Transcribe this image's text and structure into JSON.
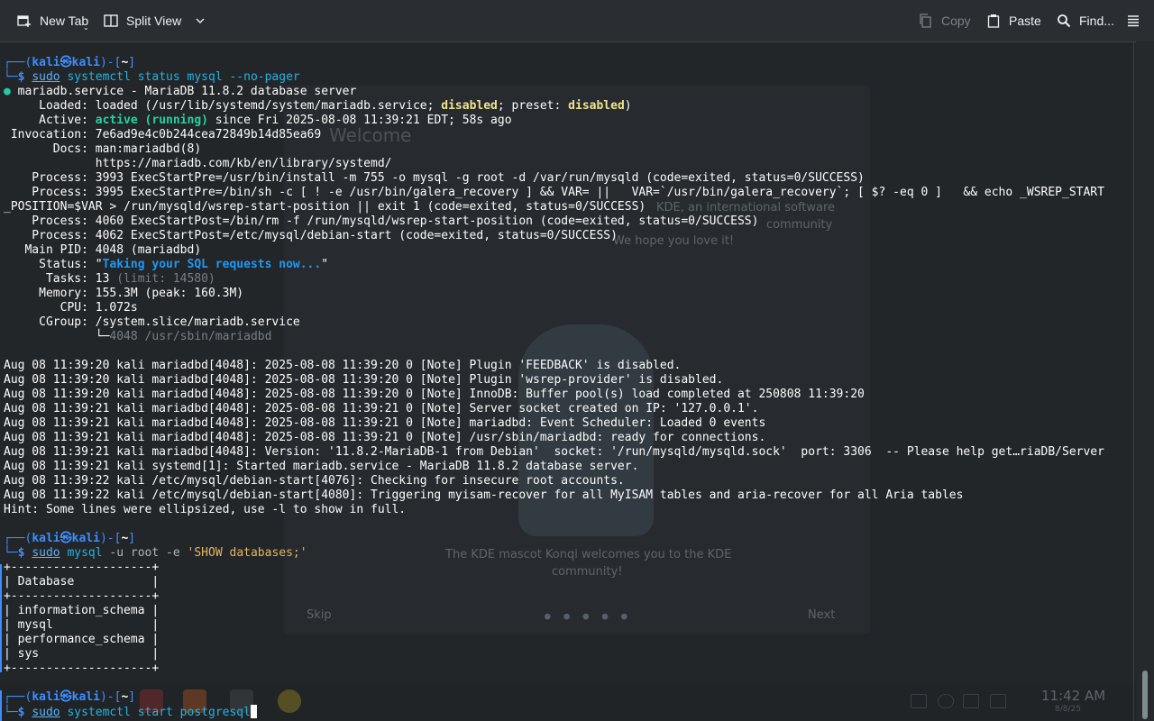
{
  "toolbar": {
    "new_tab": "New Tab",
    "split_view": "Split View",
    "copy": "Copy",
    "paste": "Paste",
    "find": "Find..."
  },
  "background": {
    "welcome_title": "Welcome",
    "welcome_line1": "KDE, an international software",
    "welcome_line2": "community",
    "welcome_line3": "We hope you love it!",
    "mascot_caption": "The KDE mascot Konqi welcomes you to the KDE",
    "mascot_caption2": "community!",
    "skip": "Skip",
    "next": "Next",
    "clock": "11:42 AM",
    "date": "8/8/25"
  },
  "prompt": {
    "user": "kali",
    "at": "㉿",
    "host": "kali",
    "dir": "~"
  },
  "commands": {
    "cmd1_sudo": "sudo",
    "cmd1_rest": "systemctl status mysql --no-pager",
    "cmd2_sudo": "sudo",
    "cmd2_mysql": "mysql",
    "cmd2_flags": "-u root -e",
    "cmd2_string": "'SHOW databases;'",
    "cmd3_sudo": "sudo",
    "cmd3_rest": "systemctl start postgresql"
  },
  "status": {
    "header": "mariadb.service - MariaDB 11.8.2 database server",
    "loaded_label": "     Loaded:",
    "loaded_pre": " loaded (/usr/lib/systemd/system/mariadb.service; ",
    "loaded_disabled": "disabled",
    "loaded_mid": "; preset: ",
    "loaded_preset": "disabled",
    "loaded_post": ")",
    "active_label": "     Active:",
    "active_state": "active (running)",
    "active_since": " since Fri 2025-08-08 11:39:21 EDT; 58s ago",
    "invocation": " Invocation: 7e6ad9e4c0b244cea72849b14d85ea69",
    "docs1": "       Docs: man:mariadbd(8)",
    "docs2": "             https://mariadb.com/kb/en/library/systemd/",
    "process1": "    Process: 3993 ExecStartPre=/usr/bin/install -m 755 -o mysql -g root -d /var/run/mysqld (code=exited, status=0/SUCCESS)",
    "process2a": "    Process: 3995 ExecStartPre=/bin/sh -c [ ! -e /usr/bin/galera_recovery ] && VAR= ||   VAR=`/usr/bin/galera_recovery`; [ $? -eq 0 ]   && echo _WSREP_START",
    "process2b": "_POSITION=$VAR > /run/mysqld/wsrep-start-position || exit 1 (code=exited, status=0/SUCCESS)",
    "process3": "    Process: 4060 ExecStartPost=/bin/rm -f /run/mysqld/wsrep-start-position (code=exited, status=0/SUCCESS)",
    "process4": "    Process: 4062 ExecStartPost=/etc/mysql/debian-start (code=exited, status=0/SUCCESS)",
    "main_pid": "   Main PID: 4048 (mariadbd)",
    "status_label": "     Status: ",
    "status_quote_open": "\"",
    "status_value": "Taking your SQL requests now...",
    "status_quote_close": "\"",
    "tasks_label": "      Tasks: 13 ",
    "tasks_limit": "(limit: 14580)",
    "memory": "     Memory: 155.3M (peak: 160.3M)",
    "cpu": "        CPU: 1.072s",
    "cgroup": "     CGroup: /system.slice/mariadb.service",
    "cgroup_tree": "             └─",
    "cgroup_proc": "4048 /usr/sbin/mariadbd"
  },
  "logs": [
    "Aug 08 11:39:20 kali mariadbd[4048]: 2025-08-08 11:39:20 0 [Note] Plugin 'FEEDBACK' is disabled.",
    "Aug 08 11:39:20 kali mariadbd[4048]: 2025-08-08 11:39:20 0 [Note] Plugin 'wsrep-provider' is disabled.",
    "Aug 08 11:39:20 kali mariadbd[4048]: 2025-08-08 11:39:20 0 [Note] InnoDB: Buffer pool(s) load completed at 250808 11:39:20",
    "Aug 08 11:39:21 kali mariadbd[4048]: 2025-08-08 11:39:21 0 [Note] Server socket created on IP: '127.0.0.1'.",
    "Aug 08 11:39:21 kali mariadbd[4048]: 2025-08-08 11:39:21 0 [Note] mariadbd: Event Scheduler: Loaded 0 events",
    "Aug 08 11:39:21 kali mariadbd[4048]: 2025-08-08 11:39:21 0 [Note] /usr/sbin/mariadbd: ready for connections.",
    "Aug 08 11:39:21 kali mariadbd[4048]: Version: '11.8.2-MariaDB-1 from Debian'  socket: '/run/mysqld/mysqld.sock'  port: 3306  -- Please help get…riaDB/Server",
    "Aug 08 11:39:21 kali systemd[1]: Started mariadb.service - MariaDB 11.8.2 database server.",
    "Aug 08 11:39:22 kali /etc/mysql/debian-start[4076]: Checking for insecure root accounts.",
    "Aug 08 11:39:22 kali /etc/mysql/debian-start[4080]: Triggering myisam-recover for all MyISAM tables and aria-recover for all Aria tables",
    "Hint: Some lines were ellipsized, use -l to show in full."
  ],
  "db_table": {
    "border": "+--------------------+",
    "header": "| Database           |",
    "rows": [
      "| information_schema |",
      "| mysql              |",
      "| performance_schema |",
      "| sys                |"
    ]
  }
}
